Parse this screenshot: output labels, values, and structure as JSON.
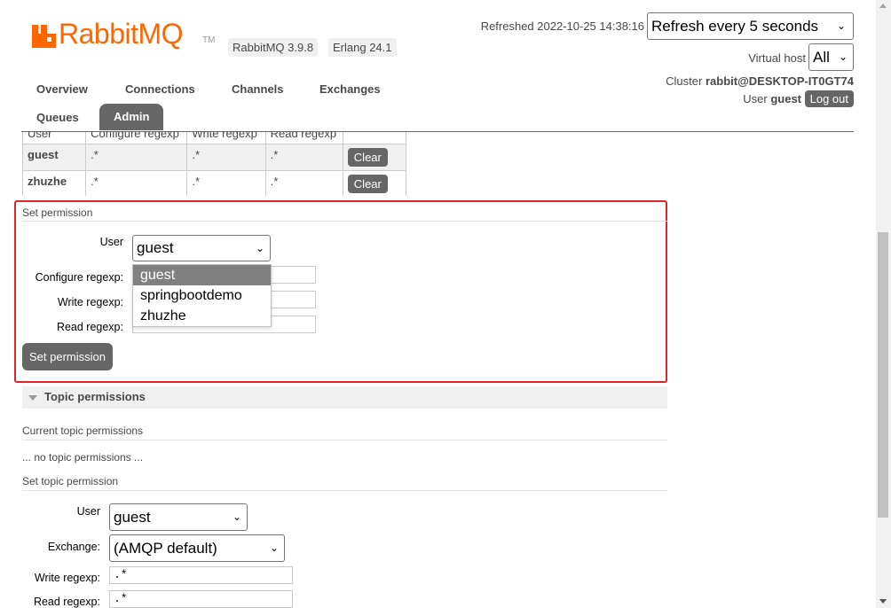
{
  "header": {
    "logo_text": "RabbitMQ",
    "logo_tm": "TM",
    "version_badge": "RabbitMQ 3.9.8",
    "erlang_badge": "Erlang 24.1",
    "refreshed_label": "Refreshed 2022-10-25 14:38:16",
    "refresh_select": "Refresh every 5 seconds",
    "vhost_label": "Virtual host",
    "vhost_select": "All",
    "cluster_label": "Cluster",
    "cluster_name": "rabbit@DESKTOP-IT0GT74",
    "user_label": "User",
    "user_name": "guest",
    "logout_label": "Log out",
    "brand_color": "#ff6600"
  },
  "nav": {
    "overview": "Overview",
    "connections": "Connections",
    "channels": "Channels",
    "exchanges": "Exchanges",
    "queues": "Queues",
    "admin": "Admin"
  },
  "permissions_table": {
    "headers": [
      "User",
      "Configure regexp",
      "Write regexp",
      "Read regexp"
    ],
    "rows": [
      {
        "user": "guest",
        "configure": ".*",
        "write": ".*",
        "read": ".*",
        "action": "Clear"
      },
      {
        "user": "zhuzhe",
        "configure": ".*",
        "write": ".*",
        "read": ".*",
        "action": "Clear"
      }
    ]
  },
  "set_permission": {
    "section_title": "Set permission",
    "user_label": "User",
    "user_value": "guest",
    "user_options": [
      "guest",
      "springbootdemo",
      "zhuzhe"
    ],
    "configure_label": "Configure regexp:",
    "write_label": "Write regexp:",
    "read_label": "Read regexp:",
    "read_value": ".*",
    "submit_label": "Set permission"
  },
  "topic_permissions": {
    "title": "Topic permissions",
    "current_title": "Current topic permissions",
    "empty_text": "... no topic permissions ...",
    "set_title": "Set topic permission",
    "user_label": "User",
    "user_value": "guest",
    "exchange_label": "Exchange:",
    "exchange_value": "(AMQP default)",
    "write_label": "Write regexp:",
    "write_value": ".*",
    "read_label": "Read regexp:",
    "read_value": ".*"
  }
}
